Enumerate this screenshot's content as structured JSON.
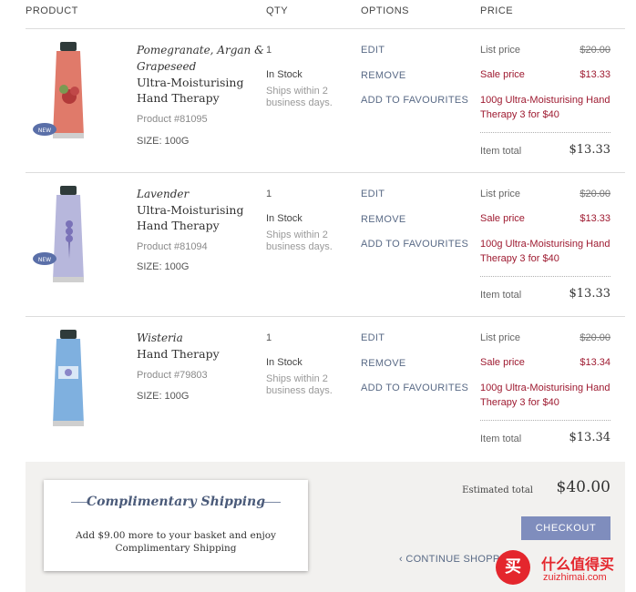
{
  "header": {
    "product": "PRODUCT",
    "qty": "QTY",
    "options": "OPTIONS",
    "price": "PRICE"
  },
  "colors": {
    "sale_red": "#9e1a30",
    "link_blue": "#596a86",
    "checkout_button": "#7f8dbd",
    "footer_bg": "#f2f1ef"
  },
  "items": [
    {
      "name_italic_1": "Pomegranate, Argan &",
      "name_italic_2": "Grapeseed",
      "name_1": "Ultra-Moisturising",
      "name_2": "Hand Therapy",
      "product_number": "Product #81095",
      "size": "SIZE: 100G",
      "badge": "NEW",
      "qty": "1",
      "stock": "In Stock",
      "ships": "Ships within 2 business days.",
      "edit": "EDIT",
      "remove": "REMOVE",
      "favourites": "ADD TO FAVOURITES",
      "list_price_label": "List price",
      "list_price": "$20.00",
      "sale_price_label": "Sale price",
      "sale_price": "$13.33",
      "promo": "100g Ultra-Moisturising Hand Therapy 3 for $40",
      "item_total_label": "Item total",
      "item_total": "$13.33"
    },
    {
      "name_italic_1": "Lavender",
      "name_1": "Ultra-Moisturising",
      "name_2": "Hand Therapy",
      "product_number": "Product #81094",
      "size": "SIZE: 100G",
      "badge": "NEW",
      "qty": "1",
      "stock": "In Stock",
      "ships": "Ships within 2 business days.",
      "edit": "EDIT",
      "remove": "REMOVE",
      "favourites": "ADD TO FAVOURITES",
      "list_price_label": "List price",
      "list_price": "$20.00",
      "sale_price_label": "Sale price",
      "sale_price": "$13.33",
      "promo": "100g Ultra-Moisturising Hand Therapy 3 for $40",
      "item_total_label": "Item total",
      "item_total": "$13.33"
    },
    {
      "name_italic_1": "Wisteria",
      "name_1": "Hand Therapy",
      "product_number": "Product #79803",
      "size": "SIZE: 100G",
      "qty": "1",
      "stock": "In Stock",
      "ships": "Ships within 2 business days.",
      "edit": "EDIT",
      "remove": "REMOVE",
      "favourites": "ADD TO FAVOURITES",
      "list_price_label": "List price",
      "list_price": "$20.00",
      "sale_price_label": "Sale price",
      "sale_price": "$13.34",
      "promo": "100g Ultra-Moisturising Hand Therapy 3 for $40",
      "item_total_label": "Item total",
      "item_total": "$13.34"
    }
  ],
  "shipping_promo": {
    "title": "Complimentary Shipping",
    "text": "Add $9.00 more to your basket and enjoy Complimentary Shipping"
  },
  "summary": {
    "estimated_total_label": "Estimated total",
    "estimated_total": "$40.00",
    "checkout_label": "CHECKOUT",
    "continue_label": "CONTINUE SHOPPING"
  },
  "watermark": {
    "icon_char": "买",
    "cn_text": "什么值得买",
    "url": "zuizhimai.com"
  }
}
